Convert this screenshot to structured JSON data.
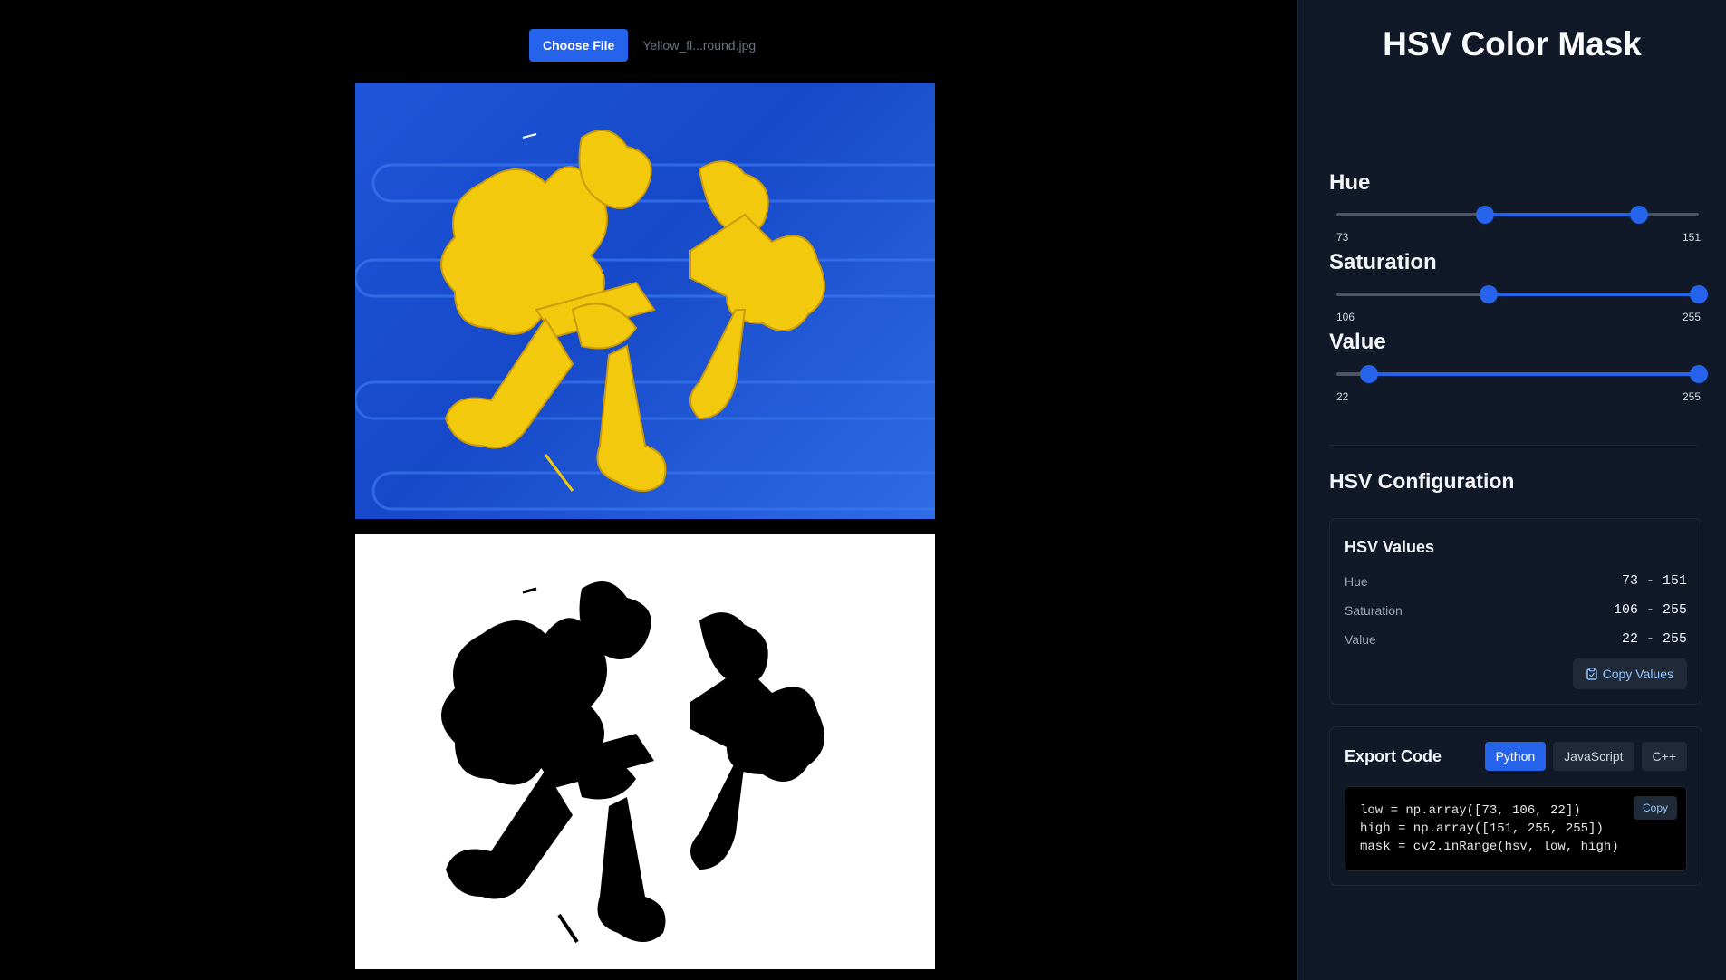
{
  "upload": {
    "button_label": "Choose File",
    "file_name": "Yellow_fl...round.jpg"
  },
  "colors": {
    "accent": "#2563eb",
    "panel_bg": "#111827",
    "photo_bg": "#1f55d9",
    "flower": "#f2c90c"
  },
  "panel": {
    "title": "HSV Color Mask"
  },
  "sliders": [
    {
      "label": "Hue",
      "min_label": "73",
      "max_label": "151",
      "low_fraction": 0.41,
      "high_fraction": 0.835
    },
    {
      "label": "Saturation",
      "min_label": "106",
      "max_label": "255",
      "low_fraction": 0.42,
      "high_fraction": 1.0
    },
    {
      "label": "Value",
      "min_label": "22",
      "max_label": "255",
      "low_fraction": 0.09,
      "high_fraction": 1.0
    }
  ],
  "config": {
    "title": "HSV Configuration",
    "values_title": "HSV Values",
    "rows": [
      {
        "name": "Hue",
        "value": "73 - 151"
      },
      {
        "name": "Saturation",
        "value": "106 - 255"
      },
      {
        "name": "Value",
        "value": "22 - 255"
      }
    ],
    "copy_values_label": "Copy Values",
    "copy_icon": "clipboard-icon"
  },
  "export": {
    "title": "Export Code",
    "tabs": [
      "Python",
      "JavaScript",
      "C++"
    ],
    "active_tab": "Python",
    "code_lines": [
      "low = np.array([73, 106, 22])",
      "high = np.array([151, 255, 255])",
      "mask = cv2.inRange(hsv, low, high)"
    ],
    "copy_label": "Copy"
  }
}
